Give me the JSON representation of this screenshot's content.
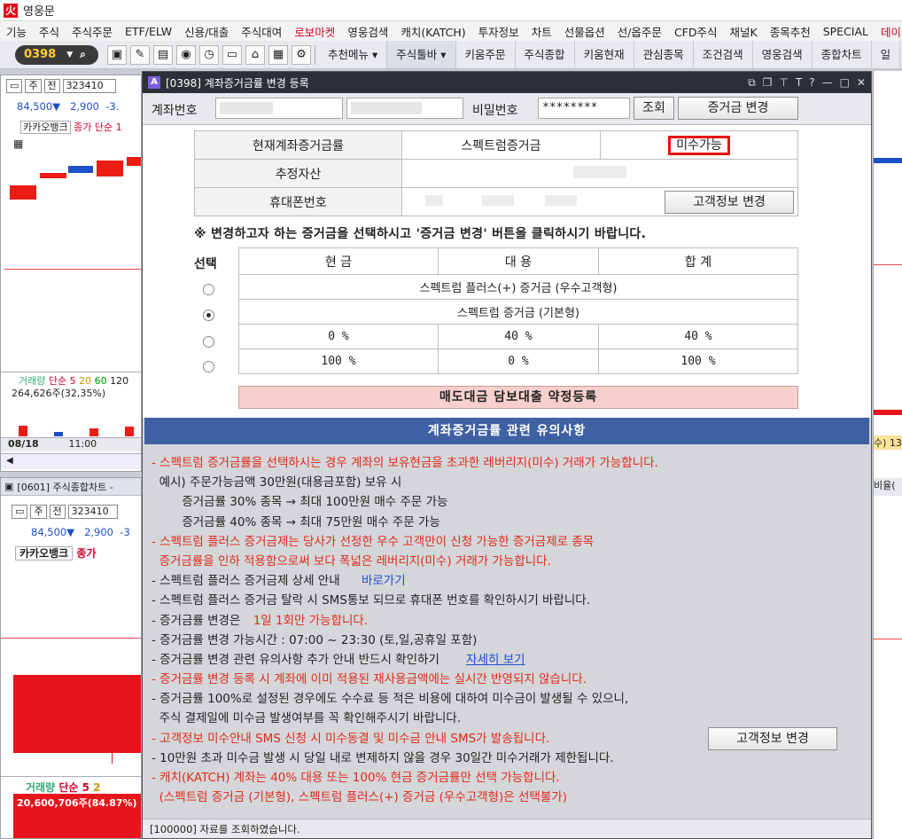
{
  "app": {
    "title": "영웅문"
  },
  "menu": [
    "기능",
    "주식",
    "주식주문",
    "ETF/ELW",
    "신용/대출",
    "주식대여",
    "로보마켓",
    "영웅검색",
    "캐치(KATCH)",
    "투자정보",
    "차트",
    "선물옵션",
    "선/옵주문",
    "CFD주식",
    "채널K",
    "종목추천",
    "SPECIAL",
    "데이"
  ],
  "toolbar": {
    "code": "0398",
    "menus": [
      "추천메뉴",
      "주식툴바",
      "키움주문",
      "주식종합",
      "키움현재",
      "관심종목",
      "조건검색",
      "영웅검색",
      "종합차트",
      "일"
    ]
  },
  "leftTop": {
    "tab1": "주",
    "tab2": "전",
    "code": "323410",
    "price": "84,500",
    "change": "2,900",
    "rate": "-3.",
    "stock": "카카오뱅크",
    "legend": "종가 단순 1",
    "volLegend": [
      "거래량",
      "단순 5",
      "20",
      "60",
      "120"
    ],
    "volValue": "264,626주(32,35%)",
    "date": "08/18",
    "time": "11:00"
  },
  "leftBottom": {
    "header": "[0601] 주식종합차트 -",
    "tab1": "주",
    "tab2": "전",
    "code": "323410",
    "price": "84,500",
    "change": "2,900",
    "rate": "-3",
    "stock": "카카오뱅크",
    "legend": "종가",
    "volLegend": [
      "거래량",
      "단순 5",
      "2"
    ],
    "volValue": "20,600,706주(84.87%)"
  },
  "rightStrip": {
    "label1": "수) 13",
    "label2": "비율("
  },
  "dialog": {
    "title": "[0398] 계좌증거금률 변경 등록",
    "accountLabel": "계좌번호",
    "passwordLabel": "비밀번호",
    "password": "********",
    "queryButton": "조회",
    "changeButton": "증거금 변경",
    "info": {
      "currentRateLabel": "현재계좌증거금률",
      "currentRateValue": "스펙트럼증거금",
      "marginStatus": "미수가능",
      "assetLabel": "추정자산",
      "phoneLabel": "휴대폰번호",
      "customerInfoButton": "고객정보 변경"
    },
    "notice": "※ 변경하고자 하는 증거금을 선택하시고 '증거금 변경' 버튼을 클릭하시기 바랍니다.",
    "selectLabel": "선택",
    "options": {
      "headers": [
        "현 금",
        "대 용",
        "합 계"
      ],
      "rows": [
        {
          "label": "스펙트럼 플러스(+) 증거금 (우수고객형)",
          "selected": false
        },
        {
          "label": "스펙트럼 증거금 (기본형)",
          "selected": true
        },
        {
          "cells": [
            "0 %",
            "40 %",
            "40 %"
          ],
          "selected": false
        },
        {
          "cells": [
            "100 %",
            "0 %",
            "100 %"
          ],
          "selected": false
        }
      ]
    },
    "loanButton": "매도대금 담보대출 약정등록",
    "cautionTitle": "계좌증거금률 관련 유의사항",
    "cautions": [
      {
        "text": "- 스펙트럼 증거금률을 선택하시는 경우 계좌의 보유현금을 초과한 레버리지(미수) 거래가 가능합니다.",
        "color": "red"
      },
      {
        "text": "  예시) 주문가능금액 30만원(대용금포함) 보유 시",
        "color": "black"
      },
      {
        "text": "        증거금률 30% 종목 → 최대 100만원 매수 주문 가능",
        "color": "black"
      },
      {
        "text": "        증거금률 40% 종목 → 최대 75만원 매수 주문 가능",
        "color": "black"
      },
      {
        "text": "- 스펙트럼 플러스 증거금제는 당사가 선정한 우수 고객만이 신청 가능한 증거금제로 종목",
        "color": "red"
      },
      {
        "text": "  증거금률을 인하 적용함으로써 보다 폭넓은 레버리지(미수) 거래가 가능합니다.",
        "color": "red"
      },
      {
        "text": "- 스펙트럼 플러스 증거금제 상세 안내",
        "color": "black",
        "link": "바로가기"
      },
      {
        "text": "- 스펙트럼 플러스 증거금 탈락 시 SMS통보 되므로 휴대폰 번호를 확인하시기 바랍니다.",
        "color": "black"
      },
      {
        "text": "- 증거금률 변경은",
        "color": "black",
        "redTail": "1일 1회만 가능합니다."
      },
      {
        "text": "- 증거금률 변경 가능시간 : 07:00 ~ 23:30 (토,일,공휴일 포함)",
        "color": "black"
      },
      {
        "text": "- 증거금률 변경 관련 유의사항 추가 안내 반드시 확인하기",
        "color": "black",
        "link": "자세히 보기"
      },
      {
        "text": "- 증거금률 변경 등록 시 계좌에 이미 적용된 재사용금액에는 실시간 반영되지 않습니다.",
        "color": "red"
      },
      {
        "text": "- 증거금률 100%로 설정된 경우에도 수수료 등 적은 비용에 대하여 미수금이 발생될 수 있으니,",
        "color": "black"
      },
      {
        "text": "  주식 결제일에 미수금 발생여부를 꼭 확인해주시기 바랍니다.",
        "color": "black"
      },
      {
        "text": "- 고객정보 미수안내 SMS 신청 시 미수동결 및 미수금 안내 SMS가 발송됩니다.",
        "color": "red"
      },
      {
        "text": "- 10만원 초과 미수금 발생 시 당일 내로 변제하지 않을 경우 30일간 미수거래가 제한됩니다.",
        "color": "black"
      },
      {
        "text": "- 캐치(KATCH) 계좌는 40% 대용 또는 100% 현금 증거금률만 선택 가능합니다.",
        "color": "red"
      },
      {
        "text": "  (스펙트럼 증거금 (기본형), 스펙트럼 플러스(+) 증거금 (우수고객형)은 선택불가)",
        "color": "red"
      }
    ],
    "customerInfoButton2": "고객정보 변경",
    "status": "[100000] 자료를 조회하였습니다."
  },
  "colors": {
    "accent": "#3f61a3",
    "warn": "#e12b1c",
    "link": "#1e4fd6",
    "brand": "#e30613"
  }
}
